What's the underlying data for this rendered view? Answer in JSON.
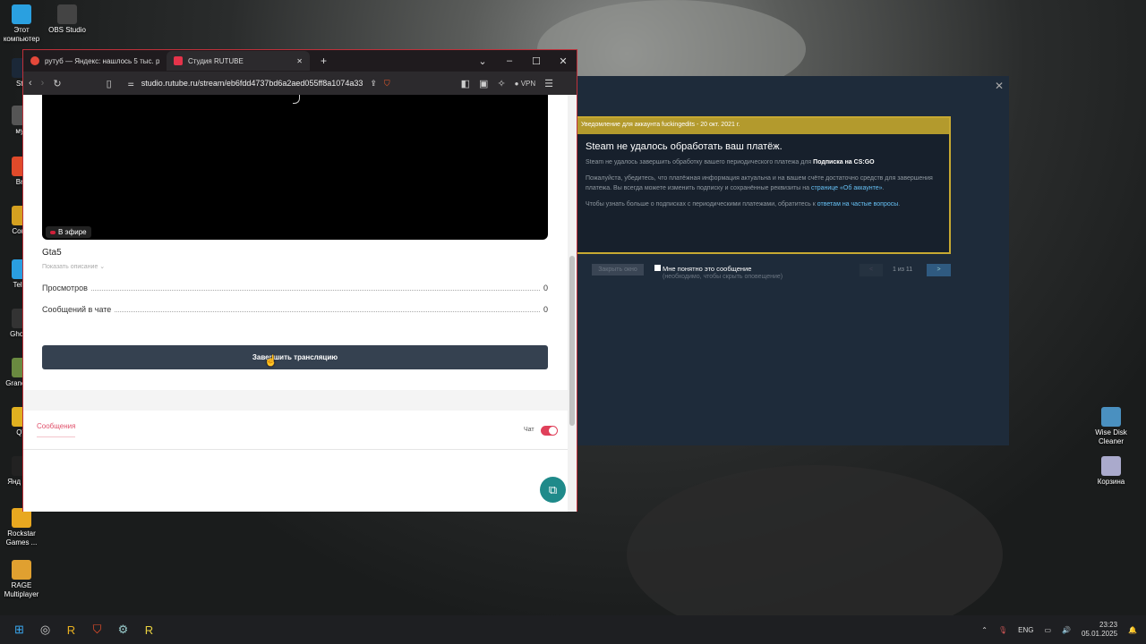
{
  "desktop": {
    "icons_left": [
      {
        "label": "Этот компьютер",
        "color": "#2aa0e0"
      },
      {
        "label": "OBS Studio",
        "color": "#444"
      },
      {
        "label": "Ste",
        "color": "#1b2838"
      },
      {
        "label": "муз",
        "color": "#555"
      },
      {
        "label": "Bra",
        "color": "#e04a2a"
      },
      {
        "label": "Count",
        "color": "#d4a020"
      },
      {
        "label": "Teleg",
        "color": "#2a9ee0"
      },
      {
        "label": "Ghost_",
        "color": "#333"
      },
      {
        "label": "Granc Aut",
        "color": "#6a8a40"
      },
      {
        "label": "QV",
        "color": "#e0b020"
      },
      {
        "label": "Янд Муз",
        "color": "#222"
      },
      {
        "label": "Rockstar Games ...",
        "color": "#e8a820"
      },
      {
        "label": "RAGE Multiplayer",
        "color": "#e0a030"
      }
    ],
    "icons_right": [
      {
        "label": "Wise Disk Cleaner",
        "color": "#4a90c0"
      },
      {
        "label": "Корзина",
        "color": "#aac"
      }
    ]
  },
  "browser": {
    "tabs": [
      {
        "label": "рутуб — Яндекс: нашлось 5 тыс. р"
      },
      {
        "label": "Студия RUTUBE"
      }
    ],
    "url": "studio.rutube.ru/stream/eb6fdd4737bd6a2aed055ff8a1074a33",
    "vpn": "VPN",
    "page": {
      "live_badge": "В эфире",
      "title": "Gta5",
      "show_description": "Показать описание",
      "stats": [
        {
          "label": "Просмотров",
          "value": "0"
        },
        {
          "label": "Сообщений в чате",
          "value": "0"
        }
      ],
      "end_button": "Завершить трансляцию",
      "messages_tab": "Сообщения",
      "chat_toggle_label": "Чат",
      "chat_enabled": true
    }
  },
  "steam": {
    "header": "Уведомление для аккаунта fuckingedits - 20 окт. 2021 г.",
    "title": "Steam не удалось обработать ваш платёж.",
    "p1": "Steam не удалось завершить обработку вашего периодического платежа для ",
    "p1_bold": "Подписка на CS:GO",
    "p2": "Пожалуйста, убедитесь, что платёжная информация актуальна и на вашем счёте достаточно средств для завершения платежа. Вы всегда можете изменить подписку и сохранённые реквизиты на ",
    "p2_link": "странице «Об аккаунте»",
    "p3": "Чтобы узнать больше о подписках с периодическими платежами, обратитесь к ",
    "p3_link": "ответам на частые вопросы",
    "close_button": "Закрыть окно",
    "ack_label": "Мне понятно это сообщение",
    "ack_hint": "(необходимо, чтобы скрыть оповещение)",
    "pager": "1 из 11",
    "prev": "<",
    "next": ">"
  },
  "taskbar": {
    "lang": "ENG",
    "time": "23:23",
    "date": "05.01.2025"
  }
}
